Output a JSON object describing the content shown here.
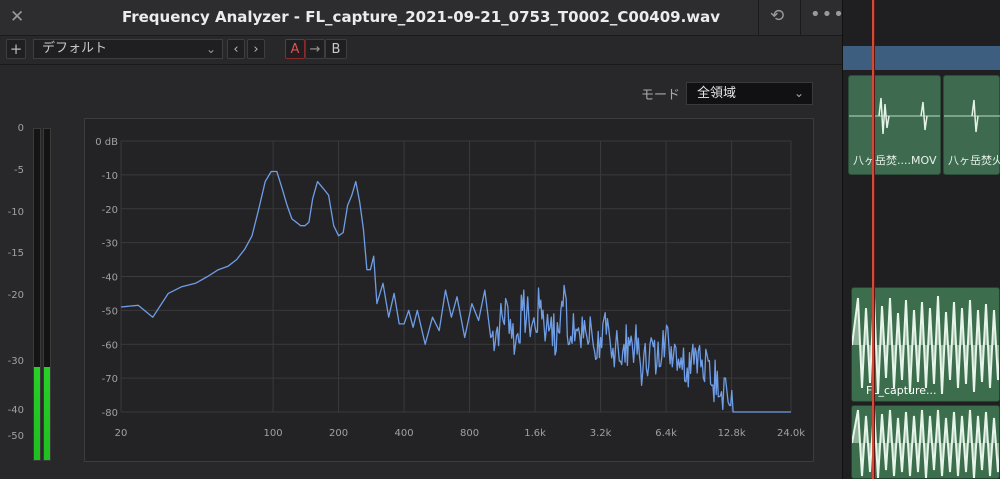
{
  "window": {
    "title": "Frequency Analyzer - FL_capture_2021-09-21_0753_T0002_C00409.wav",
    "close_icon": "close-icon",
    "history_icon": "history-icon",
    "more_icon": "more-icon"
  },
  "toolbar": {
    "add_label": "+",
    "preset_value": "デフォルト",
    "prev_label": "‹",
    "next_label": "›",
    "a_label": "A",
    "copy_label": "→",
    "b_label": "B"
  },
  "mode": {
    "label": "モード",
    "value": "全領域"
  },
  "meter": {
    "scale": [
      "0",
      "-5",
      "-10",
      "-15",
      "-20",
      "-30",
      "-40",
      "-50"
    ],
    "level_left": 0.28,
    "level_right": 0.28,
    "color": "#1fbf1f"
  },
  "chart_data": {
    "type": "line",
    "title": "",
    "xlabel": "",
    "ylabel": "",
    "x_scale": "log",
    "xlim": [
      20,
      24000
    ],
    "ylim": [
      -80,
      0
    ],
    "x_ticks": [
      "20",
      "100",
      "200",
      "400",
      "800",
      "1.6k",
      "3.2k",
      "6.4k",
      "12.8k",
      "24.0k"
    ],
    "y_ticks": [
      "0 dB",
      "-10",
      "-20",
      "-30",
      "-40",
      "-50",
      "-60",
      "-70",
      "-80"
    ],
    "grid": true,
    "line_color": "#6f9de6",
    "series": [
      {
        "x": [
          20,
          24,
          28,
          33,
          38,
          44,
          50,
          56,
          62,
          68,
          74,
          80,
          86,
          92,
          98,
          104,
          110,
          116,
          122,
          128,
          134,
          140,
          146,
          152,
          160,
          170,
          180,
          190,
          200,
          210,
          220,
          230,
          240,
          250,
          260,
          270,
          280,
          290,
          300,
          320,
          340,
          360,
          380,
          400,
          420,
          440,
          460,
          500,
          540,
          580,
          620,
          660,
          700,
          760,
          820,
          880,
          940,
          1000,
          1100,
          1200,
          1300,
          1400,
          1500,
          1600,
          1700,
          1800,
          1900,
          2000,
          2100,
          2200,
          2300,
          2400,
          2500,
          2600,
          2700,
          2800,
          2900,
          3000,
          3200,
          3400,
          3600,
          3800,
          4000,
          4300,
          4600,
          5000,
          5400,
          5800,
          6200,
          6600,
          7000,
          7500,
          8000,
          8500,
          9000,
          9500,
          10000,
          10500,
          11000,
          11500,
          12000,
          12500,
          13000,
          14000,
          15000,
          16000,
          18000,
          20000,
          24000
        ],
        "y": [
          -49,
          -48.5,
          -52,
          -45,
          -43,
          -42,
          -40,
          -38,
          -37,
          -35,
          -32,
          -28,
          -20,
          -12,
          -9,
          -9,
          -14,
          -19,
          -23,
          -24,
          -25,
          -25,
          -24,
          -17,
          -12,
          -14,
          -16,
          -25,
          -28,
          -27,
          -19,
          -16,
          -12,
          -18,
          -26,
          -38,
          -38,
          -34,
          -48,
          -42,
          -52,
          -45,
          -54,
          -54,
          -50,
          -55,
          -50,
          -60,
          -52,
          -56,
          -44,
          -52,
          -46,
          -58,
          -48,
          -53,
          -44,
          -58,
          -54,
          -49,
          -60,
          -50,
          -53,
          -55,
          -47,
          -56,
          -52,
          -62,
          -50,
          -45,
          -60,
          -51,
          -56,
          -61,
          -53,
          -60,
          -55,
          -62,
          -58,
          -57,
          -64,
          -56,
          -66,
          -58,
          -60,
          -68,
          -60,
          -66,
          -56,
          -61,
          -60,
          -64,
          -67,
          -60,
          -62,
          -70,
          -65,
          -72,
          -68,
          -74,
          -70,
          -78,
          -80,
          -80,
          -80,
          -80,
          -80,
          -80,
          -80
        ]
      }
    ]
  },
  "timeline": {
    "clip1_label": "八ヶ岳焚....MOV",
    "clip2_label": "八ヶ岳焚火",
    "clip3_label": "FL_capture...",
    "track_color": "#3d5e7e",
    "clip_color": "#3e6b50",
    "playhead_color": "#d24b3a"
  }
}
